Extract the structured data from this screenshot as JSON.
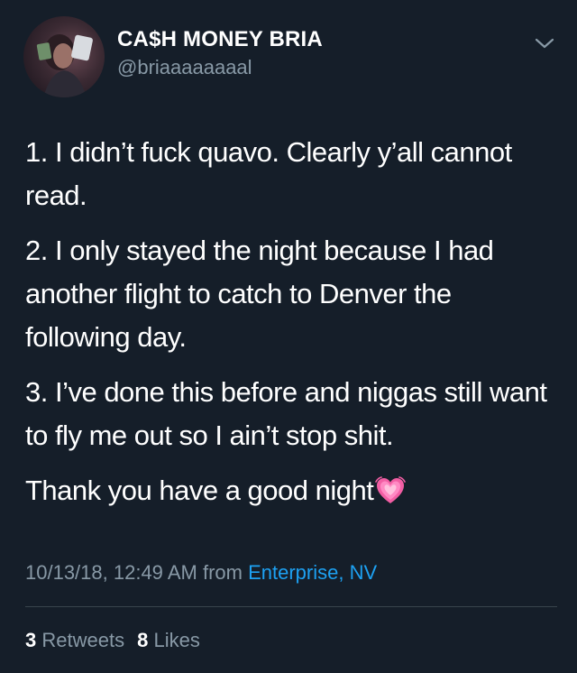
{
  "colors": {
    "background": "#151e29",
    "text": "#ffffff",
    "secondary": "#8899a6",
    "link": "#1da1f2",
    "divider": "#38444d"
  },
  "author": {
    "display_name": "CA$H MONEY BRIA",
    "handle": "@briaaaaaaaal",
    "avatar_icon": "profile-photo"
  },
  "menu_icon": "chevron-down-icon",
  "tweet": {
    "paragraphs": [
      "1. I didn’t fuck quavo. Clearly y’all cannot read.",
      "2. I only stayed the night because I had another flight to catch to Denver the following day.",
      "3. I’ve done this before and niggas still want to fly me out so I ain’t stop shit.",
      "Thank you have a good night"
    ],
    "emoji": "growing-heart-emoji"
  },
  "meta": {
    "timestamp": "10/13/18, 12:49 AM",
    "from_label": "from",
    "source": "Enterprise, NV"
  },
  "stats": {
    "retweets_count": "3",
    "retweets_label": "Retweets",
    "likes_count": "8",
    "likes_label": "Likes"
  }
}
